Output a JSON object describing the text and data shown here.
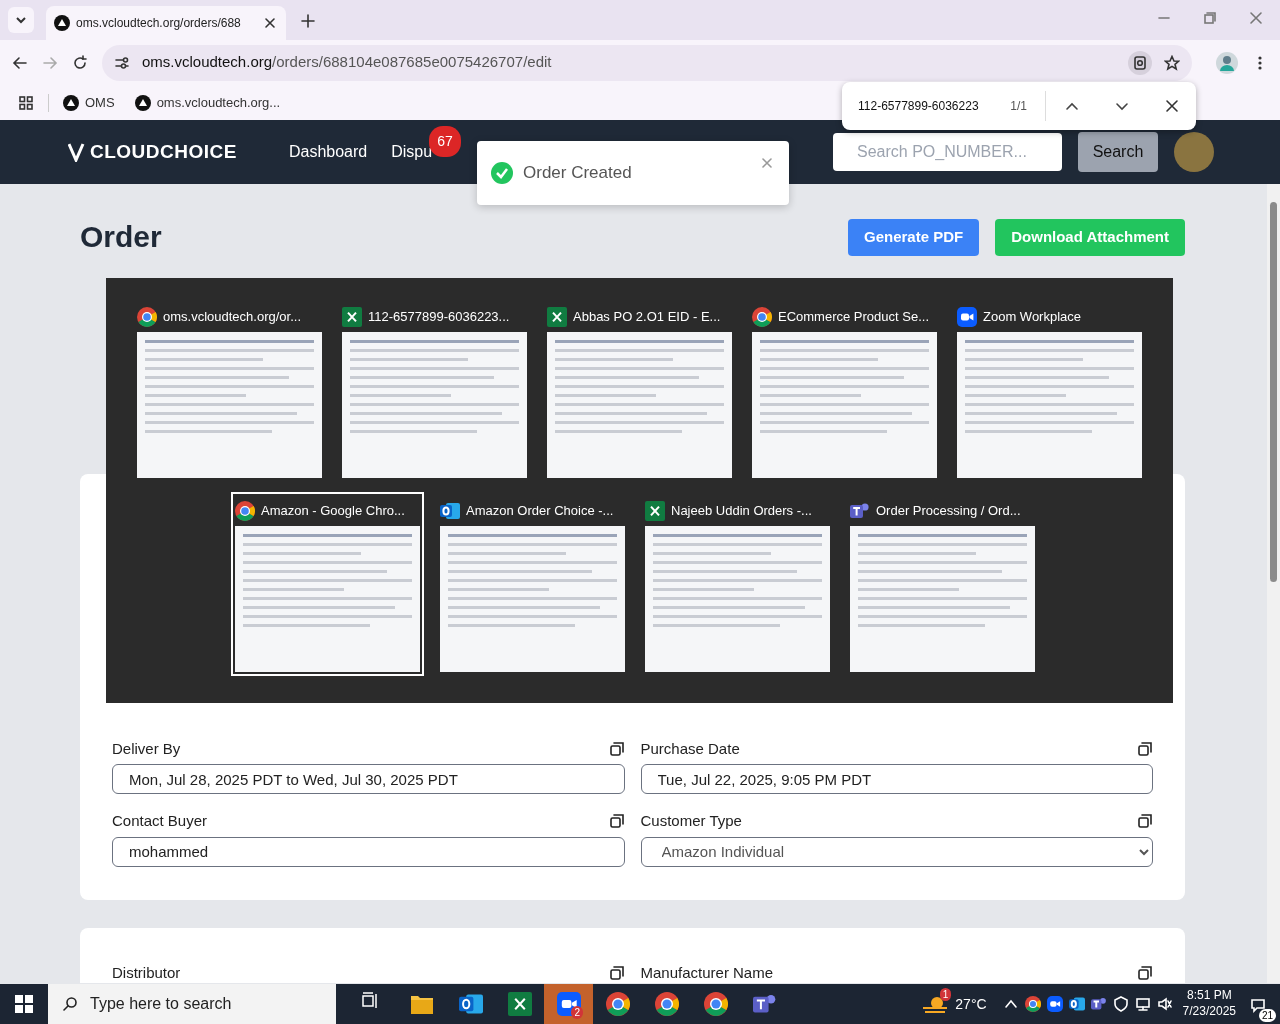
{
  "browser": {
    "tabs": [
      {
        "title": "oms.vcloudtech.org/orders/688",
        "selected": true
      }
    ],
    "url_host": "oms.vcloudtech.org",
    "url_path": "/orders/688104e087685e0075426707/edit",
    "bookmarks": [
      "OMS",
      "oms.vcloudtech.org..."
    ],
    "find_bar": {
      "query": "112-6577899-6036223",
      "count": "1/1"
    }
  },
  "navbar": {
    "logo": "CLOUDCHOICE",
    "links": [
      {
        "label": "Dashboard"
      },
      {
        "label": "Dispu",
        "badge": "67"
      }
    ],
    "search_placeholder": "Search PO_NUMBER...",
    "search_button": "Search"
  },
  "toast": {
    "message": "Order Created"
  },
  "page": {
    "title": "Order",
    "actions": [
      {
        "label": "Generate PDF",
        "kind": "primary"
      },
      {
        "label": "Download Attachment",
        "kind": "success"
      }
    ]
  },
  "form_fields": [
    {
      "label": "Deliver By",
      "value": "Mon, Jul 28, 2025 PDT to Wed, Jul 30, 2025 PDT",
      "kind": "text"
    },
    {
      "label": "Purchase Date",
      "value": "Tue, Jul 22, 2025, 9:05 PM PDT",
      "kind": "text"
    },
    {
      "label": "Contact Buyer",
      "value": "mohammed",
      "kind": "text"
    },
    {
      "label": "Customer Type",
      "value": "Amazon Individual",
      "kind": "select"
    }
  ],
  "second_card_fields": [
    {
      "label": "Distributor"
    },
    {
      "label": "Manufacturer Name"
    }
  ],
  "window_switcher": {
    "rows": [
      [
        {
          "title": "oms.vcloudtech.org/or...",
          "kind": "chrome",
          "selected": false
        },
        {
          "title": "112-6577899-6036223...",
          "kind": "excel",
          "selected": false
        },
        {
          "title": "Abbas PO 2.O1  EID - E...",
          "kind": "excel",
          "selected": false
        },
        {
          "title": "ECommerce Product Se...",
          "kind": "chrome",
          "selected": false
        },
        {
          "title": "Zoom Workplace",
          "kind": "zoom",
          "selected": false
        }
      ],
      [
        {
          "title": "Amazon - Google Chro...",
          "kind": "chrome",
          "selected": true
        },
        {
          "title": "Amazon Order Choice -...",
          "kind": "outlook",
          "selected": false
        },
        {
          "title": "Najeeb Uddin Orders -...",
          "kind": "excel",
          "selected": false
        },
        {
          "title": "Order Processing / Ord...",
          "kind": "teams",
          "selected": false
        }
      ]
    ]
  },
  "taskbar": {
    "search_placeholder": "Type here to search",
    "apps": [
      {
        "kind": "taskview",
        "selected": false
      },
      {
        "kind": "folder",
        "selected": false
      },
      {
        "kind": "outlook",
        "selected": false
      },
      {
        "kind": "excel",
        "selected": false
      },
      {
        "kind": "zoom",
        "selected": true,
        "badge": "2"
      },
      {
        "kind": "chrome",
        "selected": false
      },
      {
        "kind": "chrome",
        "selected": false
      },
      {
        "kind": "chrome",
        "selected": false
      },
      {
        "kind": "teams",
        "selected": false
      }
    ],
    "weather": {
      "badge": "1",
      "temperature": "27°C"
    },
    "time": "8:51 PM",
    "date": "7/23/2025",
    "notifications": "21"
  }
}
